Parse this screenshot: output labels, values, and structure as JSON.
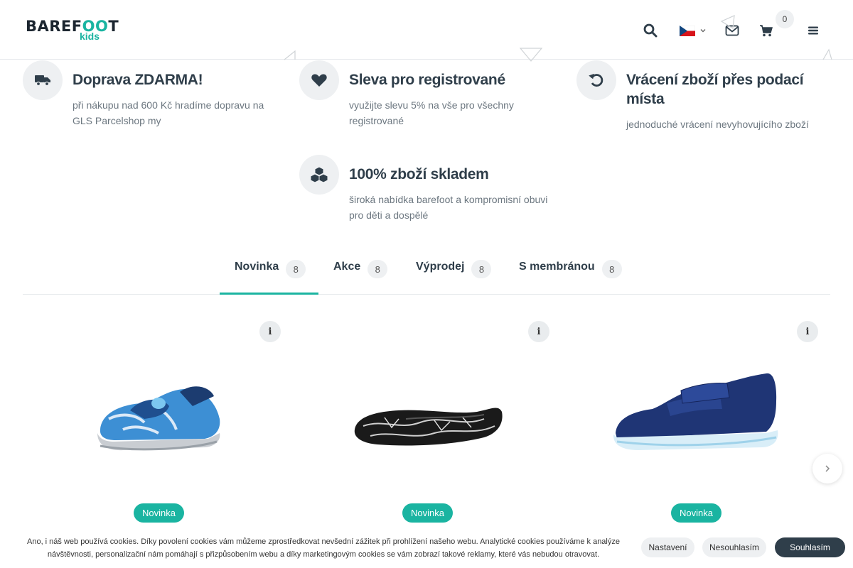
{
  "header": {
    "logo_text_left": "BAREF",
    "logo_text_oo": "OO",
    "logo_text_right": "T",
    "logo_subtext": "kids",
    "cart_count": "0",
    "icons": [
      "search-icon",
      "flag-cz-icon",
      "chevron-down-icon",
      "envelope-icon",
      "cart-icon",
      "menu-icon"
    ]
  },
  "benefits": [
    {
      "title": "Doprava ZDARMA!",
      "text": "při nákupu nad 600 Kč hradíme dopravu na GLS Parcelshop my",
      "icon": "truck-icon"
    },
    {
      "title": "Sleva pro registrované",
      "text": "využijte slevu 5% na vše pro všechny registrované",
      "icon": "heart-icon"
    },
    {
      "title": "Vrácení zboží přes podací místa",
      "text": "jednoduché vrácení nevyhovujícího zboží",
      "icon": "rotate-icon"
    },
    {
      "title": "100% zboží skladem",
      "text": "široká nabídka barefoot a kompromisní obuvi pro děti a dospělé",
      "icon": "cubes-icon"
    }
  ],
  "tabs": [
    {
      "label": "Novinka",
      "count": "8",
      "active": true
    },
    {
      "label": "Akce",
      "count": "8",
      "active": false
    },
    {
      "label": "Výprodej",
      "count": "8",
      "active": false
    },
    {
      "label": "S membránou",
      "count": "8",
      "active": false
    }
  ],
  "products": [
    {
      "badge": "Novinka",
      "image": "blue-sandal"
    },
    {
      "badge": "Novinka",
      "image": "black-ballet-flat"
    },
    {
      "badge": "Novinka",
      "image": "navy-sneaker"
    }
  ],
  "cookie": {
    "text": "Ano, i náš web používá cookies. Díky povolení cookies vám můžeme zprostředkovat nevšední zážitek při prohlížení našeho webu. Analytické cookies používáme k analýze návštěvnosti, personalizační nám pomáhají s přizpůsobením webu a díky marketingovým cookies se vám zobrazí takové reklamy, které vás nebudou otravovat.",
    "settings": "Nastavení",
    "decline": "Nesouhlasím",
    "accept": "Souhlasím"
  },
  "colors": {
    "accent": "#1ab4a1",
    "dark": "#2f3e4a",
    "chip": "#eef0f2"
  }
}
